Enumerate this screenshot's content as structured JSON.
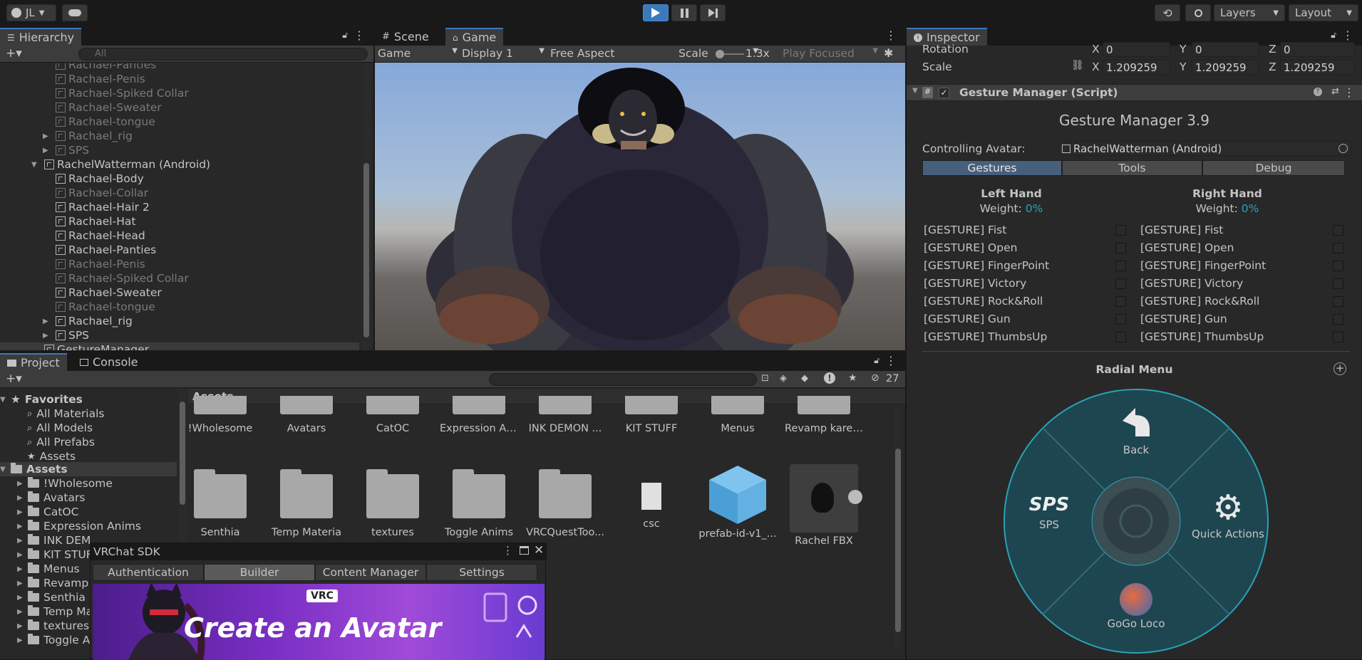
{
  "topbar": {
    "account": "JL",
    "layers": "Layers",
    "layout": "Layout"
  },
  "hierarchy": {
    "tab": "Hierarchy",
    "search_placeholder": "All",
    "rows": [
      {
        "label": "Rachael-Panties",
        "dim": true,
        "indent": 1,
        "arrow": ""
      },
      {
        "label": "Rachael-Penis",
        "dim": true,
        "indent": 1,
        "arrow": ""
      },
      {
        "label": "Rachael-Spiked Collar",
        "dim": true,
        "indent": 1,
        "arrow": ""
      },
      {
        "label": "Rachael-Sweater",
        "dim": true,
        "indent": 1,
        "arrow": ""
      },
      {
        "label": "Rachael-tongue",
        "dim": true,
        "indent": 1,
        "arrow": ""
      },
      {
        "label": "Rachael_rig",
        "dim": true,
        "indent": 1,
        "arrow": "▶"
      },
      {
        "label": "SPS",
        "dim": true,
        "indent": 1,
        "arrow": "▶"
      },
      {
        "label": "RachelWatterman (Android)",
        "dim": false,
        "indent": 0,
        "arrow": "▼"
      },
      {
        "label": "Rachael-Body",
        "dim": false,
        "indent": 1,
        "arrow": ""
      },
      {
        "label": "Rachael-Collar",
        "dim": true,
        "indent": 1,
        "arrow": ""
      },
      {
        "label": "Rachael-Hair 2",
        "dim": false,
        "indent": 1,
        "arrow": ""
      },
      {
        "label": "Rachael-Hat",
        "dim": false,
        "indent": 1,
        "arrow": ""
      },
      {
        "label": "Rachael-Head",
        "dim": false,
        "indent": 1,
        "arrow": ""
      },
      {
        "label": "Rachael-Panties",
        "dim": false,
        "indent": 1,
        "arrow": ""
      },
      {
        "label": "Rachael-Penis",
        "dim": true,
        "indent": 1,
        "arrow": ""
      },
      {
        "label": "Rachael-Spiked Collar",
        "dim": true,
        "indent": 1,
        "arrow": ""
      },
      {
        "label": "Rachael-Sweater",
        "dim": false,
        "indent": 1,
        "arrow": ""
      },
      {
        "label": "Rachael-tongue",
        "dim": true,
        "indent": 1,
        "arrow": ""
      },
      {
        "label": "Rachael_rig",
        "dim": false,
        "indent": 1,
        "arrow": "▶"
      },
      {
        "label": "SPS",
        "dim": false,
        "indent": 1,
        "arrow": "▶"
      },
      {
        "label": "GestureManager",
        "dim": false,
        "indent": 0,
        "arrow": "",
        "selected": true
      }
    ]
  },
  "game": {
    "tab_scene": "Scene",
    "tab_game": "Game",
    "mode": "Game",
    "display": "Display 1",
    "aspect": "Free Aspect",
    "scale_label": "Scale",
    "scale_value": "1.3x",
    "play_focused": "Play Focused"
  },
  "project": {
    "tab_project": "Project",
    "tab_console": "Console",
    "hidden_count": "27",
    "favorites_label": "Favorites",
    "favorites": [
      "All Materials",
      "All Models",
      "All Prefabs",
      "Assets"
    ],
    "assets_root": "Assets",
    "tree": [
      "!Wholesome",
      "Avatars",
      "CatOC",
      "Expression Anims",
      "INK DEM",
      "KIT STUF",
      "Menus",
      "Revamp",
      "Senthia",
      "Temp Ma",
      "textures",
      "Toggle A"
    ],
    "breadcrumb": "Assets",
    "row1": [
      "!Wholesome",
      "Avatars",
      "CatOC",
      "Expression An...",
      "INK DEMON ...",
      "KIT STUFF",
      "Menus",
      "Revamp karelia"
    ],
    "row2": [
      "Senthia",
      "Temp Materia",
      "textures",
      "Toggle Anims",
      "VRCQuestToo...",
      "csc",
      "prefab-id-v1_...",
      "Rachel FBX"
    ]
  },
  "vrc_sdk": {
    "title": "VRChat SDK",
    "tabs": [
      "Authentication",
      "Builder",
      "Content Manager",
      "Settings"
    ],
    "active_tab": "Builder",
    "banner_text": "Create an Avatar",
    "badge": "VRC"
  },
  "inspector": {
    "tab": "Inspector",
    "rotation_label": "Rotation",
    "rotation": {
      "x": "0",
      "y": "0",
      "z": "0"
    },
    "scale_label": "Scale",
    "scale": {
      "x": "1.209259",
      "y": "1.209259",
      "z": "1.209259"
    },
    "component": "Gesture Manager (Script)",
    "heading": "Gesture Manager 3.9",
    "controlling_label": "Controlling Avatar:",
    "controlling_value": "RachelWatterman (Android)",
    "mode_tabs": [
      "Gestures",
      "Tools",
      "Debug"
    ],
    "left_hand": "Left Hand",
    "right_hand": "Right Hand",
    "weight_label": "Weight:",
    "weight_left": "0%",
    "weight_right": "0%",
    "gestures": [
      "[GESTURE] Fist",
      "[GESTURE] Open",
      "[GESTURE] FingerPoint",
      "[GESTURE] Victory",
      "[GESTURE] Rock&Roll",
      "[GESTURE] Gun",
      "[GESTURE] ThumbsUp"
    ],
    "radial_title": "Radial Menu",
    "radial": {
      "back": "Back",
      "sps": "SPS",
      "sps_icon": "SPS",
      "quick": "Quick Actions",
      "gogo": "GoGo Loco"
    },
    "accent": "#2aa1b8"
  }
}
